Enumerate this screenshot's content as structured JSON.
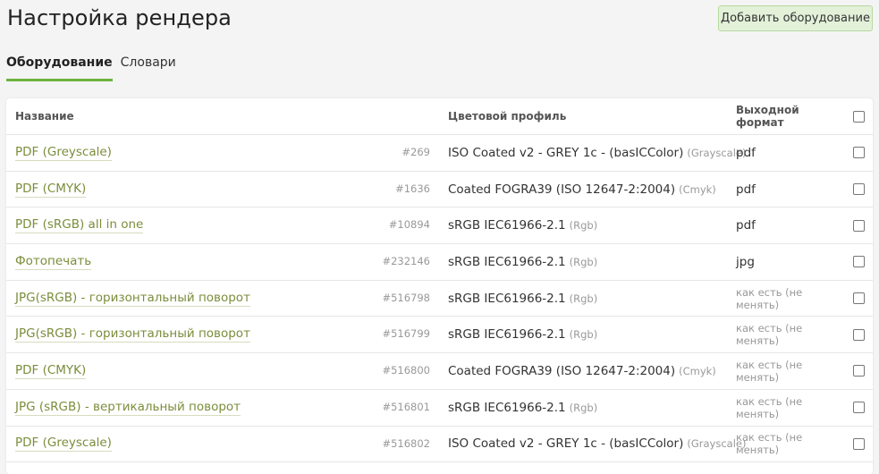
{
  "page": {
    "title": "Настройка рендера",
    "add_button_label": "Добавить оборудование"
  },
  "tabs": [
    {
      "label": "Оборудование",
      "active": true
    },
    {
      "label": "Словари",
      "active": false
    }
  ],
  "table": {
    "headers": {
      "name": "Название",
      "profile": "Цветовой профиль",
      "format": "Выходной формат"
    },
    "rows": [
      {
        "name": "PDF (Greyscale)",
        "id": "#269",
        "profile": "ISO Coated v2 - GREY 1c - (basICColor)",
        "profile_type": "(Grayscale)",
        "format": "pdf"
      },
      {
        "name": "PDF (CMYK)",
        "id": "#1636",
        "profile": "Coated FOGRA39 (ISO 12647-2:2004)",
        "profile_type": "(Cmyk)",
        "format": "pdf"
      },
      {
        "name": "PDF (sRGB) all in one",
        "id": "#10894",
        "profile": "sRGB IEC61966-2.1",
        "profile_type": "(Rgb)",
        "format": "pdf"
      },
      {
        "name": "Фотопечать",
        "id": "#232146",
        "profile": "sRGB IEC61966-2.1",
        "profile_type": "(Rgb)",
        "format": "jpg"
      },
      {
        "name": "JPG(sRGB) - горизонтальный поворот",
        "id": "#516798",
        "profile": "sRGB IEC61966-2.1",
        "profile_type": "(Rgb)",
        "format": "как есть (не менять)"
      },
      {
        "name": "JPG(sRGB) - горизонтальный поворот",
        "id": "#516799",
        "profile": "sRGB IEC61966-2.1",
        "profile_type": "(Rgb)",
        "format": "как есть (не менять)"
      },
      {
        "name": "PDF (CMYK)",
        "id": "#516800",
        "profile": "Coated FOGRA39 (ISO 12647-2:2004)",
        "profile_type": "(Cmyk)",
        "format": "как есть (не менять)"
      },
      {
        "name": "JPG (sRGB) - вертикальный поворот",
        "id": "#516801",
        "profile": "sRGB IEC61966-2.1",
        "profile_type": "(Rgb)",
        "format": "как есть (не менять)"
      },
      {
        "name": "PDF (Greyscale)",
        "id": "#516802",
        "profile": "ISO Coated v2 - GREY 1c - (basICColor)",
        "profile_type": "(Grayscale)",
        "format": "как есть (не менять)"
      }
    ]
  },
  "colors": {
    "accent": "#6cb33e",
    "link": "#7b8d3b",
    "button_bg": "#e3f1d9"
  }
}
